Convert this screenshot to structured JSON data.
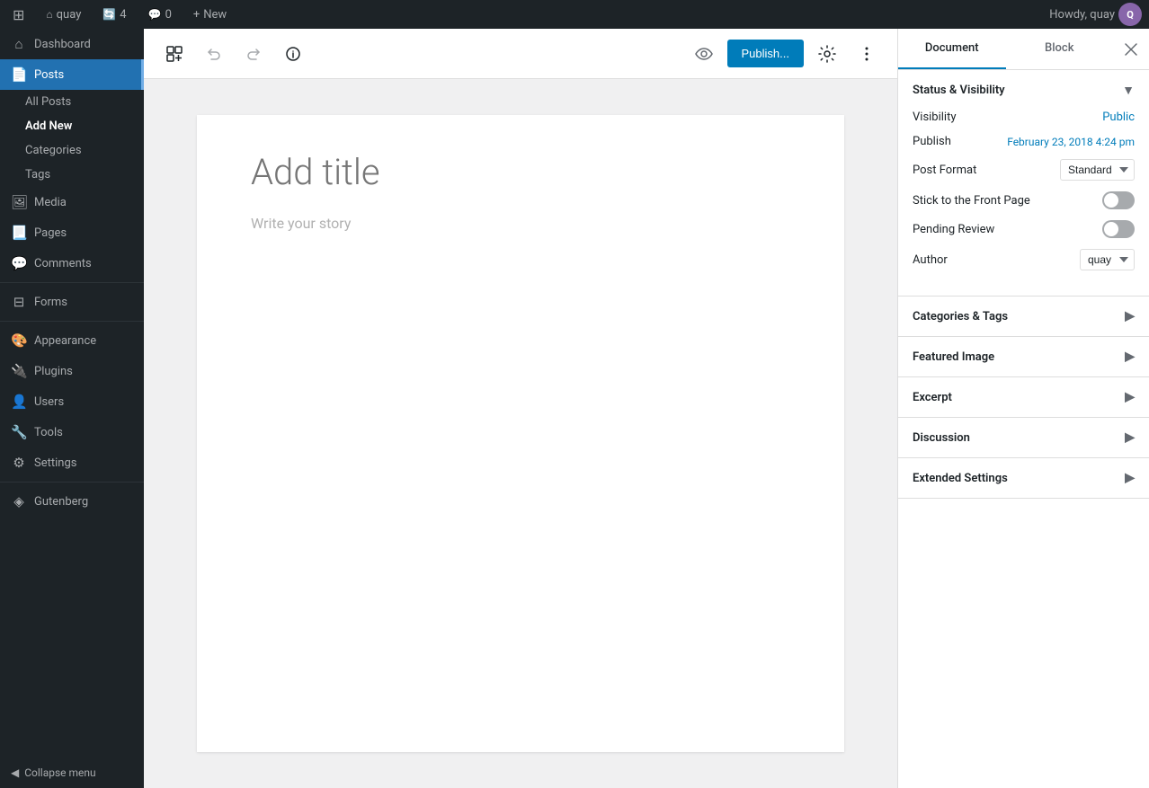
{
  "adminBar": {
    "logo": "⊞",
    "siteName": "quay",
    "updates": "4",
    "commentsLabel": "0",
    "newLabel": "New",
    "howdyText": "Howdy, quay"
  },
  "sidebar": {
    "items": [
      {
        "id": "dashboard",
        "label": "Dashboard",
        "icon": "⌂"
      },
      {
        "id": "posts",
        "label": "Posts",
        "icon": "📄",
        "active": true
      },
      {
        "id": "media",
        "label": "Media",
        "icon": "🖼"
      },
      {
        "id": "pages",
        "label": "Pages",
        "icon": "📃"
      },
      {
        "id": "comments",
        "label": "Comments",
        "icon": "💬"
      },
      {
        "id": "forms",
        "label": "Forms",
        "icon": "⊟"
      },
      {
        "id": "appearance",
        "label": "Appearance",
        "icon": "🎨"
      },
      {
        "id": "plugins",
        "label": "Plugins",
        "icon": "🔌"
      },
      {
        "id": "users",
        "label": "Users",
        "icon": "👤"
      },
      {
        "id": "tools",
        "label": "Tools",
        "icon": "🔧"
      },
      {
        "id": "settings",
        "label": "Settings",
        "icon": "⚙"
      },
      {
        "id": "gutenberg",
        "label": "Gutenberg",
        "icon": "◈"
      }
    ],
    "subItems": [
      {
        "id": "all-posts",
        "label": "All Posts"
      },
      {
        "id": "add-new",
        "label": "Add New",
        "active": true
      },
      {
        "id": "categories",
        "label": "Categories"
      },
      {
        "id": "tags",
        "label": "Tags"
      }
    ],
    "collapseLabel": "Collapse menu"
  },
  "toolbar": {
    "addBlockTitle": "+",
    "undoTitle": "↩",
    "redoTitle": "↪",
    "infoTitle": "ℹ",
    "previewTitle": "👁",
    "publishLabel": "Publish...",
    "settingsTitle": "⚙",
    "moreTitle": "⋮"
  },
  "editor": {
    "titlePlaceholder": "Add title",
    "contentPlaceholder": "Write your story"
  },
  "rightPanel": {
    "tabs": [
      {
        "id": "document",
        "label": "Document",
        "active": true
      },
      {
        "id": "block",
        "label": "Block"
      }
    ],
    "sections": {
      "statusVisibility": {
        "title": "Status & Visibility",
        "expanded": true,
        "fields": {
          "visibility": {
            "label": "Visibility",
            "value": "Public"
          },
          "publish": {
            "label": "Publish",
            "value": "February 23, 2018 4:24 pm"
          },
          "postFormat": {
            "label": "Post Format",
            "value": "Standard"
          },
          "stickToFrontPage": {
            "label": "Stick to the Front Page",
            "toggled": false
          },
          "pendingReview": {
            "label": "Pending Review",
            "toggled": false
          },
          "author": {
            "label": "Author",
            "value": "quay"
          }
        }
      },
      "categoriesTags": {
        "title": "Categories & Tags",
        "expanded": false
      },
      "featuredImage": {
        "title": "Featured Image",
        "expanded": false
      },
      "excerpt": {
        "title": "Excerpt",
        "expanded": false
      },
      "discussion": {
        "title": "Discussion",
        "expanded": false
      },
      "extendedSettings": {
        "title": "Extended Settings",
        "expanded": false
      }
    }
  }
}
